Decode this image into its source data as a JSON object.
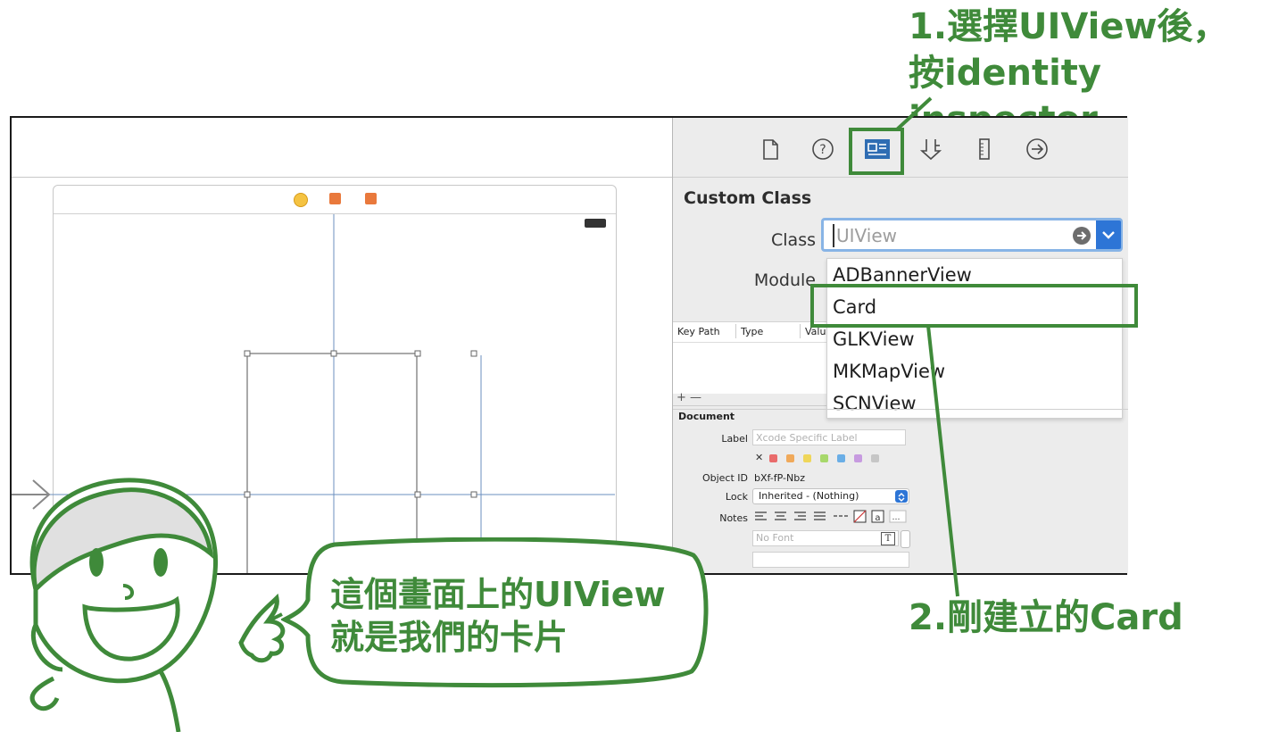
{
  "annotations": {
    "step1_line1": "1.選擇UIView後，",
    "step1_line2": "按identity inspector",
    "step2": "2.剛建立的Card",
    "speech_line1": "這個畫面上的UIView",
    "speech_line2": "就是我們的卡片"
  },
  "inspector": {
    "section_title": "Custom Class",
    "class_label": "Class",
    "class_placeholder": "UIView",
    "module_label": "Module",
    "dropdown_items": [
      "ADBannerView",
      "Card",
      "GLKView",
      "MKMapView",
      "SCNView"
    ],
    "highlighted_item": "Card",
    "columns": [
      "Key Path",
      "Type",
      "Valu"
    ],
    "add_remove": "+ —",
    "document": {
      "title": "Document",
      "label_label": "Label",
      "label_placeholder": "Xcode Specific Label",
      "clear_symbol": "✕",
      "object_id_label": "Object ID",
      "object_id_value": "bXf-fP-Nbz",
      "lock_label": "Lock",
      "lock_value": "Inherited - (Nothing)",
      "notes_label": "Notes",
      "font_placeholder": "No Font",
      "font_button": "T"
    },
    "toolbar_icons": [
      "file-inspector-icon",
      "quick-help-icon",
      "identity-inspector-icon",
      "attributes-inspector-icon",
      "size-inspector-icon",
      "connections-inspector-icon"
    ]
  },
  "colors": {
    "annotation_green": "#3f8a3a",
    "selected_icon": "#2f6db3",
    "dropdown_button": "#2d75d6",
    "label_colors": [
      "#e96b6b",
      "#f0a95a",
      "#efd65a",
      "#a7d86b",
      "#6aaee6",
      "#c79be0",
      "#c6c6c6"
    ]
  }
}
